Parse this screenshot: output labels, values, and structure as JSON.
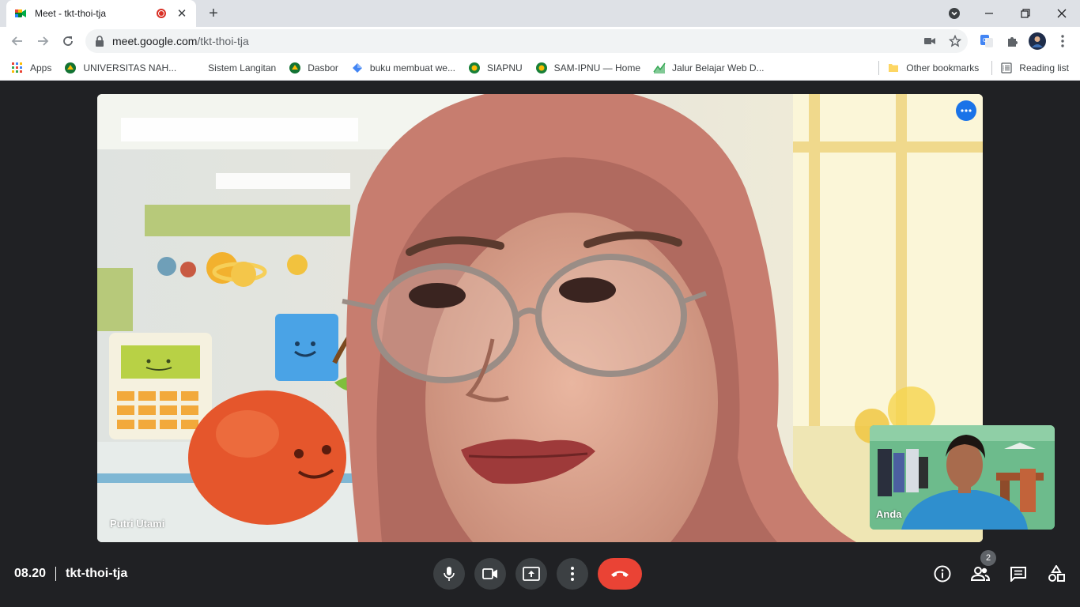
{
  "browser": {
    "tab": {
      "title": "Meet - tkt-thoi-tja",
      "recording_indicator": true
    },
    "new_tab_label": "+",
    "url": {
      "host": "meet.google.com",
      "path": "/tkt-thoi-tja"
    },
    "bookmarks": [
      {
        "label": "Apps",
        "icon": "apps-grid-icon"
      },
      {
        "label": "UNIVERSITAS NAH...",
        "icon": "university-crest-icon"
      },
      {
        "label": "Sistem Langitan",
        "icon": "blank-icon"
      },
      {
        "label": "Dasbor",
        "icon": "crest-icon"
      },
      {
        "label": "buku membuat we...",
        "icon": "diamond-icon"
      },
      {
        "label": "SIAPNU",
        "icon": "nu-globe-icon"
      },
      {
        "label": "SAM-IPNU — Home",
        "icon": "nu-globe-icon"
      },
      {
        "label": "Jalur Belajar Web D...",
        "icon": "learning-path-icon"
      }
    ],
    "other_bookmarks": "Other bookmarks",
    "reading_list": "Reading list"
  },
  "meet": {
    "main_participant": "Putri Utami",
    "self_participant": "Anda",
    "time": "08.20",
    "meeting_code": "tkt-thoi-tja",
    "participants_count": "2",
    "colors": {
      "end_call": "#ea4335",
      "accent": "#1a73e8",
      "background": "#202124"
    }
  }
}
